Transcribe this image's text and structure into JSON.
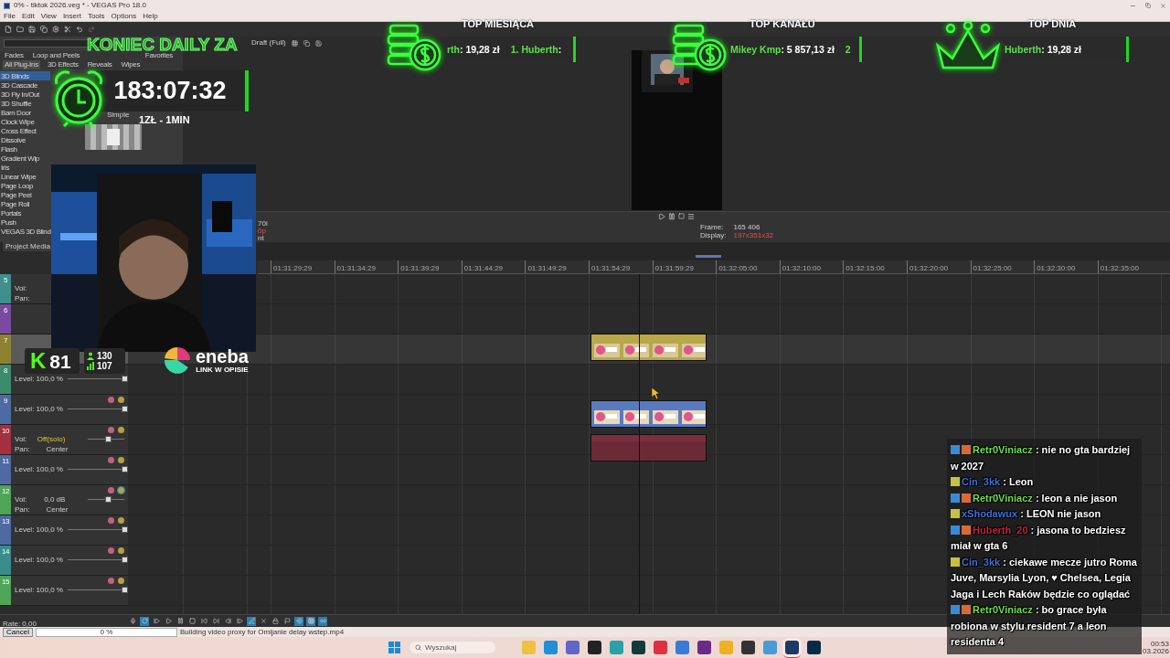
{
  "window": {
    "title": "0% - tiktok 2026.veg * - VEGAS Pro 18.0"
  },
  "menu": [
    "File",
    "Edit",
    "View",
    "Insert",
    "Tools",
    "Options",
    "Help"
  ],
  "transitions": {
    "tabs_row_1": [
      {
        "label": "Fades",
        "selected": false
      },
      {
        "label": "Loop and Peels",
        "selected": false
      },
      {
        "label": "Favorites",
        "selected": false
      }
    ],
    "tabs_row_2": [
      {
        "label": "All Plug-Ins",
        "selected": true
      },
      {
        "label": "3D Effects",
        "selected": false
      },
      {
        "label": "Reveals",
        "selected": false
      },
      {
        "label": "Wipes",
        "selected": false
      }
    ],
    "items": [
      {
        "label": "3D Blinds",
        "selected": true
      },
      {
        "label": "3D Cascade",
        "selected": false
      },
      {
        "label": "3D Fly In/Out",
        "selected": false
      },
      {
        "label": "3D Shuffle",
        "selected": false
      },
      {
        "label": "Barn Door",
        "selected": false
      },
      {
        "label": "Clock Wipe",
        "selected": false
      },
      {
        "label": "Cross Effect",
        "selected": false
      },
      {
        "label": "Dissolve",
        "selected": false
      },
      {
        "label": "Flash",
        "selected": false
      },
      {
        "label": "Gradient Wip",
        "selected": false
      },
      {
        "label": "Iris",
        "selected": false
      },
      {
        "label": "Linear Wipe",
        "selected": false
      },
      {
        "label": "Page Loop",
        "selected": false
      },
      {
        "label": "Page Peel",
        "selected": false
      },
      {
        "label": "Page Roll",
        "selected": false
      },
      {
        "label": "Portals",
        "selected": false
      },
      {
        "label": "Push",
        "selected": false
      },
      {
        "label": "VEGAS 3D Blind",
        "selected": false
      }
    ],
    "preview_label": "Simple"
  },
  "preview": {
    "quality": "Draft (Full)",
    "side_labels": [
      "70i",
      "0p",
      "nt"
    ],
    "frame_label": "Frame:",
    "frame_value": "165 406",
    "display_label": "Display:",
    "display_value": "197x351x32"
  },
  "project_media_tab": "Project Media",
  "ruler": [
    "01:31:29:29",
    "01:31:34:29",
    "01:31:39:29",
    "01:31:44:29",
    "01:31:49:29",
    "01:31:54:29",
    "01:31:59:29",
    "01:32:05:00",
    "01:32:10:00",
    "01:32:15:00",
    "01:32:20:00",
    "01:32:25:00",
    "01:32:30:00",
    "01:32:35:00"
  ],
  "tracks": [
    {
      "number": "5",
      "kind": "audio",
      "color": "#3f8f8a",
      "selected": false,
      "vol_label": "Vol:",
      "pan_label": "Pan:"
    },
    {
      "number": "6",
      "kind": "video",
      "color": "#7b4aa0",
      "selected": false
    },
    {
      "number": "7",
      "kind": "video",
      "color": "#8c8232",
      "selected": true
    },
    {
      "number": "8",
      "kind": "video",
      "color": "#3a8c6c",
      "selected": false,
      "level_text": "Level: 100,0 %",
      "level": 1
    },
    {
      "number": "9",
      "kind": "video",
      "color": "#4d6aa3",
      "selected": false,
      "level_text": "Level: 100,0 %",
      "level": 1,
      "soloed": false
    },
    {
      "number": "10",
      "kind": "audio",
      "color": "#a3303f",
      "selected": false,
      "vol_label": "Vol:",
      "vol_value": "Off(solo)",
      "muted": true,
      "pan_label": "Pan:",
      "pan_value": "Center",
      "level": 0.55,
      "soloed": false
    },
    {
      "number": "11",
      "kind": "video",
      "color": "#4d6aa3",
      "selected": false,
      "level_text": "Level: 100,0 %",
      "level": 1,
      "soloed": false
    },
    {
      "number": "12",
      "kind": "audio",
      "color": "#4ea556",
      "selected": false,
      "vol_label": "Vol:",
      "vol_value": "0,0 dB",
      "muted": false,
      "pan_label": "Pan:",
      "pan_value": "Center",
      "level": 0.55,
      "soloed": true
    },
    {
      "number": "13",
      "kind": "video",
      "color": "#4d6aa3",
      "selected": false,
      "level_text": "Level: 100,0 %",
      "level": 1,
      "soloed": false
    },
    {
      "number": "14",
      "kind": "video",
      "color": "#3a8c8c",
      "selected": false,
      "level_text": "Level: 100,0 %",
      "level": 1,
      "soloed": false
    },
    {
      "number": "15",
      "kind": "video",
      "color": "#4ea556",
      "selected": false,
      "level_text": "Level: 100,0 %",
      "level": 1,
      "soloed": false
    }
  ],
  "transport": {
    "rate": "Rate: 0,00",
    "buttons": [
      {
        "kind": "record",
        "active": false
      },
      {
        "kind": "loop",
        "active": true
      },
      {
        "kind": "play-start",
        "active": false
      },
      {
        "kind": "play",
        "active": false
      },
      {
        "kind": "pause",
        "active": false
      },
      {
        "kind": "stop",
        "active": false
      },
      {
        "kind": "prev",
        "active": false
      },
      {
        "kind": "next",
        "active": false
      },
      {
        "kind": "frame-back",
        "active": false
      },
      {
        "kind": "frame-fwd",
        "active": false
      },
      {
        "kind": "edit",
        "active": true
      },
      {
        "kind": "cut",
        "active": false
      },
      {
        "kind": "lock",
        "active": false
      },
      {
        "kind": "marker",
        "active": false
      },
      {
        "kind": "snap",
        "active": true
      },
      {
        "kind": "grid",
        "active": true
      },
      {
        "kind": "ripple",
        "active": true
      }
    ]
  },
  "status_bar": {
    "cancel": "Cancel",
    "progress": "0 %",
    "level": 0,
    "message": "Building video proxy for Omijanie delay wstep.mp4"
  },
  "taskbar": {
    "search_placeholder": "Wyszukaj",
    "apps": [
      {
        "kind": "folder",
        "selected": false
      },
      {
        "kind": "edge",
        "selected": false
      },
      {
        "kind": "teams",
        "selected": false
      },
      {
        "kind": "capcut",
        "selected": false
      },
      {
        "kind": "monitor",
        "selected": false
      },
      {
        "kind": "vegas",
        "selected": false
      },
      {
        "kind": "opera",
        "selected": false
      },
      {
        "kind": "cube",
        "selected": false
      },
      {
        "kind": "next",
        "selected": false
      },
      {
        "kind": "rockstar",
        "selected": false
      },
      {
        "kind": "obs",
        "selected": false
      },
      {
        "kind": "photos",
        "selected": false
      },
      {
        "kind": "steam",
        "selected": true
      },
      {
        "kind": "photoshop",
        "selected": false
      }
    ],
    "time": "00:53",
    "date": "03.2026"
  },
  "stream_overlay": {
    "daily_title": "KONIEC DAILY ZA",
    "timer": "183:07:32",
    "rate": "1ZŁ - 1MIN",
    "top_cards": [
      {
        "title": "TOP MIESIĄCA",
        "kind": "coins",
        "entries": [
          {
            "name": "rth",
            "amount": ": 19,28 zł"
          },
          {
            "name": "1. Huberth",
            "amount": ":"
          }
        ]
      },
      {
        "title": "TOP KANAŁU",
        "kind": "coins",
        "entries": [
          {
            "name": "Mikey Kmp",
            "amount": ": 5 857,13 zł"
          },
          {
            "name": "2"
          }
        ]
      },
      {
        "title": "TOP DNIA",
        "kind": "crown",
        "entries": [
          {
            "name": "Huberth",
            "amount": ": 19,28 zł"
          }
        ]
      }
    ],
    "kick": {
      "logo": "K",
      "viewers": "81",
      "stats": [
        "130",
        "107"
      ]
    },
    "sponsor": {
      "name": "eneba",
      "tagline": "LINK W OPISIE"
    },
    "chat": [
      {
        "user": "Retr0Viniacz",
        "color": "#6fdc4c",
        "kind": "vip",
        "text": ": nie no gta bardziej w 2027"
      },
      {
        "user": "Cin_3kk",
        "color": "#3d6fd4",
        "kind": "regular",
        "text": ": Leon"
      },
      {
        "user": "Retr0Viniacz",
        "color": "#6fdc4c",
        "kind": "vip",
        "text": ": leon a nie jason"
      },
      {
        "user": "xShodawux",
        "color": "#3d6fd4",
        "kind": "regular",
        "text": ": LEON nie jason"
      },
      {
        "user": "Huberth_20",
        "color": "#c4213c",
        "kind": "vip",
        "text": ": jasona to bedziesz miał w gta 6"
      },
      {
        "user": "Cin_3kk",
        "color": "#3d6fd4",
        "kind": "regular",
        "text": ": ciekawe mecze jutro Roma Juve, Marsylia Lyon, ♥ Chelsea, Legia Jaga i Lech Raków będzie co oglądać"
      },
      {
        "user": "Retr0Viniacz",
        "color": "#6fdc4c",
        "kind": "vip",
        "text": ": bo grace była robiona w stylu resident 7 a leon residenta 4"
      }
    ]
  }
}
